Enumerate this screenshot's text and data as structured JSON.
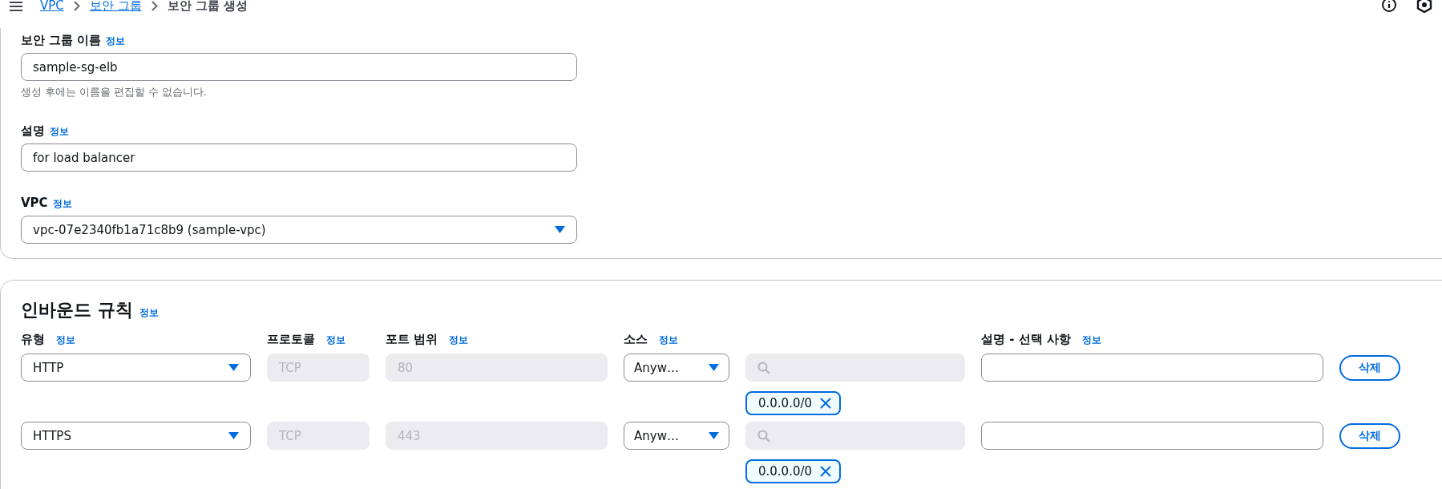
{
  "breadcrumbs": [
    {
      "label": "VPC",
      "link": true
    },
    {
      "label": "보안 그룹",
      "link": true
    },
    {
      "label": "보안 그룹 생성",
      "link": false
    }
  ],
  "basic": {
    "fields": [
      {
        "kind": "text",
        "label": "보안 그룹 이름",
        "info": "정보",
        "value": "sample-sg-elb",
        "hint": "생성 후에는 이름을 편집할 수 없습니다."
      },
      {
        "kind": "text",
        "label": "설명",
        "info": "정보",
        "value": "for load balancer"
      },
      {
        "kind": "select",
        "label": "VPC",
        "info": "정보",
        "value": "vpc-07e2340fb1a71c8b9 (sample-vpc)"
      }
    ]
  },
  "inbound": {
    "title": "인바운드 규칙",
    "info": "정보",
    "columns": [
      {
        "label": "유형",
        "info": "정보"
      },
      {
        "label": "프로토콜",
        "info": "정보"
      },
      {
        "label": "포트 범위",
        "info": "정보"
      },
      {
        "label": "소스",
        "info": "정보"
      },
      {
        "label": "설명 - 선택 사항",
        "info": "정보"
      }
    ],
    "rows": [
      {
        "type": "HTTP",
        "protocol": "TCP",
        "port": "80",
        "source": "Anyw…",
        "cidr": "0.0.0.0/0",
        "delete": "삭제"
      },
      {
        "type": "HTTPS",
        "protocol": "TCP",
        "port": "443",
        "source": "Anyw…",
        "cidr": "0.0.0.0/0",
        "delete": "삭제"
      }
    ]
  }
}
